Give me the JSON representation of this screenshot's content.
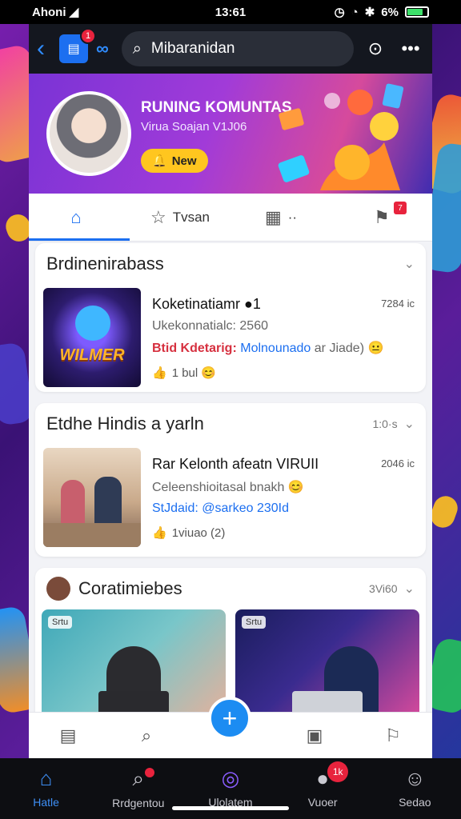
{
  "status_bar": {
    "carrier": "Ahoni",
    "carrier_icon": "wifi-bars-icon",
    "time": "13:61",
    "battery": "6%",
    "battery_level": 0.8
  },
  "top_bar": {
    "chat_badge": "1",
    "search_value": "Mibaranidan"
  },
  "hero": {
    "title": "RUNING KOMUNTAS",
    "subtitle": "Virua Soajan V1J06",
    "button": "New"
  },
  "tabs": [
    {
      "label": "",
      "icon": "home-icon",
      "active": true
    },
    {
      "label": "Tvsan",
      "icon": "star-icon"
    },
    {
      "label": "··",
      "icon": "grid-icon"
    },
    {
      "label": "",
      "icon": "notification-icon",
      "badge": "7"
    }
  ],
  "sections": {
    "first": {
      "title": "Brdinenirabass",
      "item": {
        "title": "Koketinatiamr ●1",
        "time": "7284 ic",
        "subtitle": "Ukekonnatialc: 2560",
        "line_a": "Btid Kdetarig:",
        "line_b": "Molnounado",
        "line_c": "ar Jiade) 😐",
        "stats": "1 bul 😊",
        "thumb_text": "WILMER"
      }
    },
    "second": {
      "title": "Etdhe Hindis a yarln",
      "meta": "1:0·s",
      "item": {
        "title": "Rar Kelonth afeatn VIRUII",
        "time": "2046 ic",
        "subtitle": "Celeenshioitasal bnakh 😊",
        "line_b": "StJdaid: @sarkeo 230Id",
        "stats": "1viuao (2)"
      }
    },
    "third": {
      "title": "Coratimiebes",
      "meta": "3Vi60",
      "media": [
        {
          "tag": "Srtu"
        },
        {
          "tag": "Srtu"
        }
      ]
    }
  },
  "bottom_nav": [
    {
      "label": "Hatle",
      "icon": "home-icon",
      "active": true
    },
    {
      "label": "Rrdgentou",
      "icon": "search-icon",
      "dot": true
    },
    {
      "label": "Ulolatem",
      "icon": "compass-icon"
    },
    {
      "label": "Vuoer",
      "icon": "person-icon",
      "badge": "1k"
    },
    {
      "label": "Sedao",
      "icon": "profile-icon"
    }
  ],
  "colors": {
    "accent": "#1c6ff0",
    "badge": "#e8233d",
    "hero_button": "#ffc61f"
  }
}
